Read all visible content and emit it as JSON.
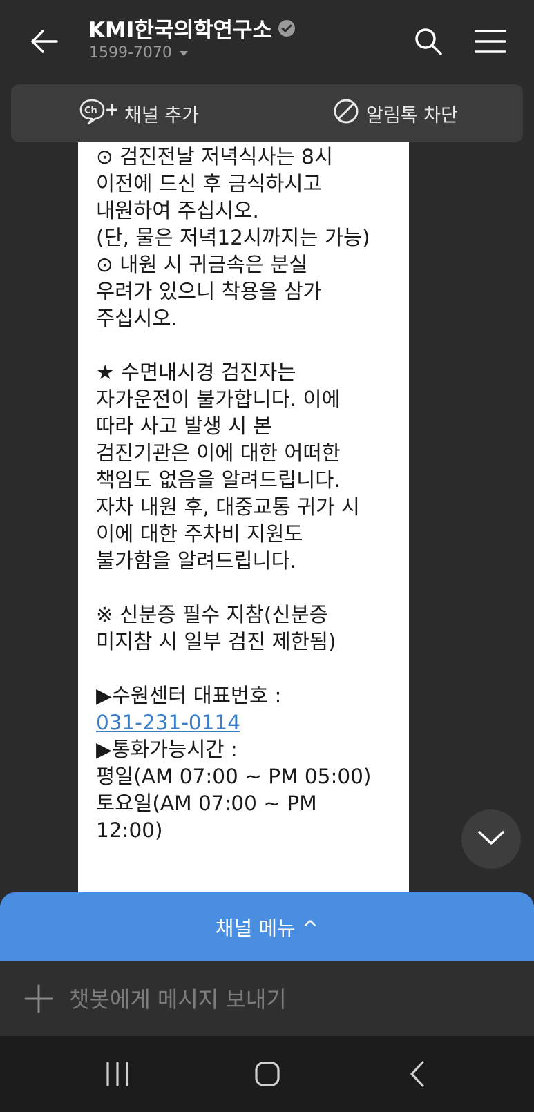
{
  "header": {
    "title": "KMI한국의학연구소",
    "phone": "1599-7070",
    "icons": {
      "back": "back-arrow-icon",
      "verified": "verified-badge-icon",
      "dropdown": "chevron-down-icon",
      "search": "search-icon",
      "menu": "hamburger-menu-icon"
    }
  },
  "actions": {
    "add_channel": "채널 추가",
    "block_alert": "알림톡 차단",
    "icons": {
      "add_channel": "channel-add-icon",
      "block_alert": "block-icon"
    }
  },
  "message": {
    "lines": [
      "⊙ 검진전날 저녁식사는 8시\n이전에 드신 후 금식하시고\n내원하여 주십시오.\n(단, 물은 저녁12시까지는 가능)",
      "⊙ 내원 시 귀금속은 분실\n우려가 있으니 착용을 삼가\n주십시오.",
      "★ 수면내시경 검진자는\n자가운전이 불가합니다. 이에\n따라 사고 발생 시 본\n검진기관은 이에 대한 어떠한\n책임도 없음을 알려드립니다.\n자차 내원 후, 대중교통 귀가 시\n이에 대한 주차비 지원도\n불가함을 알려드립니다.",
      "※ 신분증 필수 지참(신분증\n미지참 시 일부 검진 제한됨)",
      "▶수원센터 대표번호 :",
      "031-231-0114",
      "▶통화가능시간 :\n평일(AM 07:00 ~ PM 05:00)\n토요일(AM 07:00 ~ PM\n12:00)"
    ]
  },
  "bottom": {
    "channel_menu": "채널 메뉴 ^",
    "input_placeholder": "챗봇에게 메시지 보내기",
    "icons": {
      "scroll_down": "chevron-down-icon",
      "plus": "plus-icon"
    }
  },
  "navbar": {
    "icons": {
      "recents": "recent-apps-icon",
      "home": "home-icon",
      "back": "nav-back-icon"
    }
  },
  "colors": {
    "background": "#2b2b2c",
    "accent": "#4a8ee2",
    "link": "#3a7dc9",
    "bubble": "#ffffff"
  }
}
